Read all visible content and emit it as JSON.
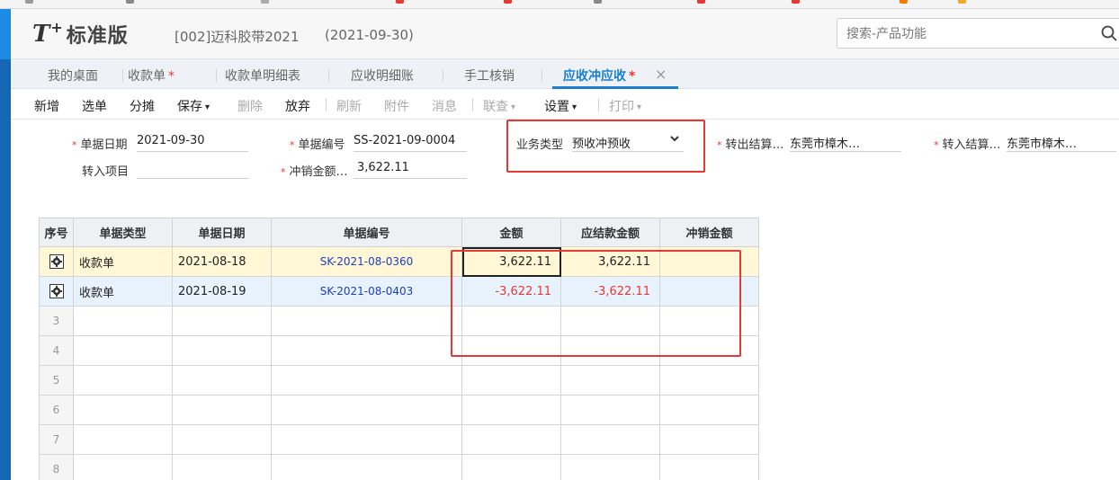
{
  "header": {
    "logo_t": "T",
    "logo_plus": "+",
    "logo_text": "标准版",
    "account": "[002]迈科胶带2021",
    "account_date": "(2021-09-30)",
    "search_placeholder": "搜索-产品功能"
  },
  "tabs": [
    {
      "label": "我的桌面",
      "star": ""
    },
    {
      "label": "收款单",
      "star": "*"
    },
    {
      "label": "收款单明细表",
      "star": ""
    },
    {
      "label": "应收明细账",
      "star": ""
    },
    {
      "label": "手工核销",
      "star": ""
    },
    {
      "label": "应收冲应收",
      "star": "*",
      "active": true
    }
  ],
  "tab_close": "×",
  "toolbar": {
    "add": "新增",
    "select": "选单",
    "allocate": "分摊",
    "save": "保存",
    "delete": "删除",
    "discard": "放弃",
    "refresh": "刷新",
    "attachment": "附件",
    "message": "消息",
    "query": "联查",
    "settings": "设置",
    "print": "打印",
    "caret": "▾"
  },
  "form": {
    "req": "*",
    "doc_date_label": "单据日期",
    "doc_date": "2021-09-30",
    "doc_no_label": "单据编号",
    "doc_no": "SS-2021-09-0004",
    "biz_type_label": "业务类型",
    "biz_type": "预收冲预收",
    "transfer_out_label": "转出结算…",
    "transfer_out": "东莞市樟木…",
    "transfer_in_label": "转入结算…",
    "transfer_in": "东莞市樟木…",
    "transfer_project_label": "转入项目",
    "transfer_project": "",
    "writeoff_amount_label": "冲销金额…",
    "writeoff_amount": "3,622.11"
  },
  "grid": {
    "columns": [
      "序号",
      "单据类型",
      "单据日期",
      "单据编号",
      "金额",
      "应结款金额",
      "冲销金额"
    ],
    "rows": [
      {
        "type": "收款单",
        "date": "2021-08-18",
        "no": "SK-2021-08-0360",
        "amount": "3,622.11",
        "settle": "3,622.11",
        "writeoff": ""
      },
      {
        "type": "收款单",
        "date": "2021-08-19",
        "no": "SK-2021-08-0403",
        "amount": "-3,622.11",
        "settle": "-3,622.11",
        "writeoff": ""
      }
    ],
    "empty_seq": [
      "3",
      "4",
      "5",
      "6",
      "7",
      "8"
    ]
  },
  "colors": {
    "accent": "#1a7fd1",
    "highlight_box": "#e53935",
    "negative": "#e53935",
    "row_selected": "#fff7d6",
    "row_hover": "#e8f2fd"
  },
  "icons": {
    "search": "magnifier-icon",
    "dropdown": "chevron-down-icon",
    "row_settings": "gear-icon",
    "tab_close": "close-icon"
  }
}
